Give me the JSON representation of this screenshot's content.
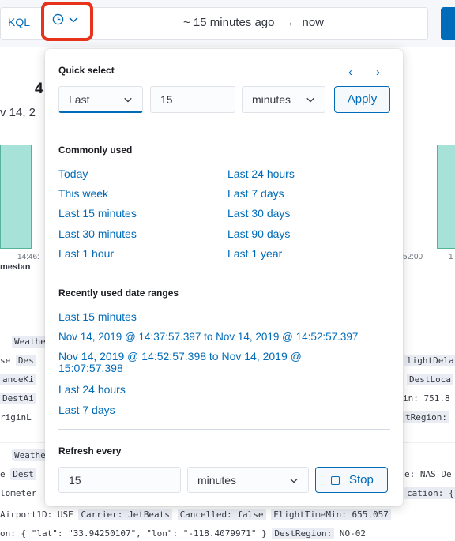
{
  "background": {
    "query_lang": "KQL",
    "date_start": "~ 15 minutes ago",
    "arrow": "→",
    "date_end": "now",
    "hits_partial": "4",
    "range_partial": "v 14, 2",
    "ticks": [
      "14:46:",
      "52:00",
      "1"
    ],
    "timestamp_partial": "mestan",
    "doc_lines": [
      {
        "parts": [
          "Weathe"
        ]
      },
      {
        "parts": [
          "se",
          "Des",
          "lightDela"
        ]
      },
      {
        "parts": [
          "anceKi",
          "DestLoca"
        ]
      },
      {
        "parts": [
          "DestAi",
          "in: 751.8"
        ]
      },
      {
        "parts": [
          "riginL",
          "tRegion: "
        ]
      },
      {
        "parts": [
          "Weathe"
        ]
      },
      {
        "parts": [
          "e",
          "Dest",
          "e: NAS De"
        ]
      },
      {
        "parts": [
          "lometer",
          "cation: {"
        ]
      },
      {
        "parts": [
          "Airport1D: USE",
          "Carrier: JetBeats",
          "Cancelled: false",
          "FlightTimeMin: 655.057"
        ]
      },
      {
        "parts": [
          "on: { \"lat\": \"33.94250107\", \"lon\": \"-118.4079971\" }",
          "DestRegion:",
          "NO-02"
        ]
      }
    ]
  },
  "quick_select": {
    "title": "Quick select",
    "prev_label": "‹",
    "next_label": "›",
    "direction": "Last",
    "value": "15",
    "unit": "minutes",
    "apply_label": "Apply"
  },
  "commonly_used": {
    "title": "Commonly used",
    "col1": [
      "Today",
      "This week",
      "Last 15 minutes",
      "Last 30 minutes",
      "Last 1 hour"
    ],
    "col2": [
      "Last 24 hours",
      "Last 7 days",
      "Last 30 days",
      "Last 90 days",
      "Last 1 year"
    ]
  },
  "recent": {
    "title": "Recently used date ranges",
    "items": [
      "Last 15 minutes",
      "Nov 14, 2019 @ 14:37:57.397 to Nov 14, 2019 @ 14:52:57.397",
      "Nov 14, 2019 @ 14:52:57.398 to Nov 14, 2019 @ 15:07:57.398",
      "Last 24 hours",
      "Last 7 days"
    ]
  },
  "refresh": {
    "title": "Refresh every",
    "value": "15",
    "unit": "minutes",
    "stop_label": "Stop"
  },
  "colors": {
    "link": "#006bb8",
    "highlight": "#e7331b",
    "bar_fill": "#a6e2d8"
  }
}
